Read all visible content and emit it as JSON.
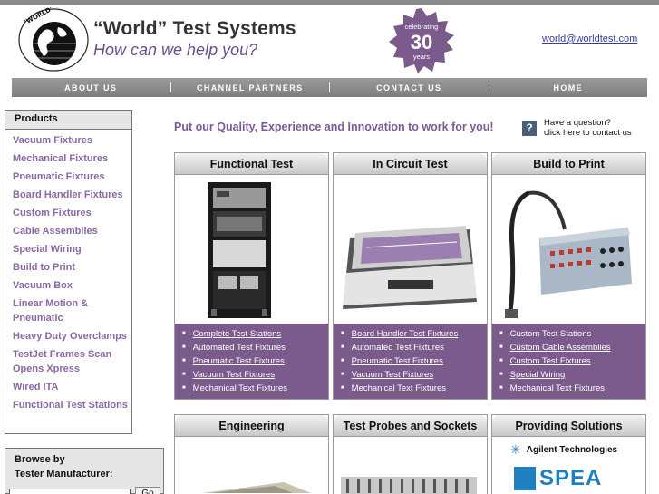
{
  "header": {
    "logo_ring_text": "\"WORLD\" TEST SYSTEMS",
    "title": "“World” Test Systems",
    "tagline": "How can we help you?",
    "badge": {
      "top": "celebrating",
      "number": "30",
      "bottom": "years"
    },
    "email": "world@worldtest.com"
  },
  "nav": {
    "items": [
      "ABOUT US",
      "CHANNEL PARTNERS",
      "CONTACT US",
      "HOME"
    ]
  },
  "sidebar": {
    "title": "Products",
    "items": [
      "Vacuum Fixtures",
      "Mechanical Fixtures",
      "Pneumatic Fixtures",
      "Board Handler Fixtures",
      "Custom Fixtures",
      "Cable Assemblies",
      "Special Wiring",
      "Build to Print",
      "Vacuum Box",
      "Linear Motion & Pneumatic",
      "Heavy Duty Overclamps",
      "TestJet Frames Scan Opens Xpress",
      "Wired ITA",
      "Functional Test Stations"
    ]
  },
  "browse": {
    "line1": "Browse by",
    "line2": "Tester Manufacturer:",
    "go": "Go"
  },
  "main": {
    "promo": "Put our Quality, Experience and Innovation to work for you!",
    "question_icon": "?",
    "question_line1": "Have a question?",
    "question_line2": "click here to contact us",
    "cards": [
      {
        "title": "Functional Test",
        "items": [
          {
            "text": "Complete Test Stations",
            "link": true
          },
          {
            "text": "Automated Test Fixtures",
            "link": false
          },
          {
            "text": "Pneumatic Test Fixtures",
            "link": true
          },
          {
            "text": "Vacuum Test Fixtures",
            "link": true
          },
          {
            "text": "Mechanical Text Fixtures",
            "link": true
          }
        ]
      },
      {
        "title": "In Circuit Test",
        "items": [
          {
            "text": "Board Handler Test Fixtures",
            "link": true
          },
          {
            "text": "Automated Test Fixtures",
            "link": false
          },
          {
            "text": "Pneumatic Test Fixtures",
            "link": true
          },
          {
            "text": "Vacuum Test Fixtures",
            "link": true
          },
          {
            "text": "Mechanical Text Fixtures",
            "link": true
          }
        ]
      },
      {
        "title": "Build to Print",
        "items": [
          {
            "text": "Custom Test Stations",
            "link": false
          },
          {
            "text": "Custom Cable Assemblies",
            "link": true
          },
          {
            "text": "Custom Test Fixtures",
            "link": true
          },
          {
            "text": "Special Wiring",
            "link": true
          },
          {
            "text": "Mechanical Text Fixtures",
            "link": true
          }
        ]
      }
    ],
    "cards2": [
      {
        "title": "Engineering"
      },
      {
        "title": "Test Probes and Sockets"
      },
      {
        "title": "Providing Solutions",
        "logo1": "Agilent Technologies",
        "logo2": "SPEA"
      }
    ]
  },
  "colors": {
    "accent": "#7b5a8c",
    "nav": "#8a8a8a",
    "link": "#8a6aa3"
  }
}
